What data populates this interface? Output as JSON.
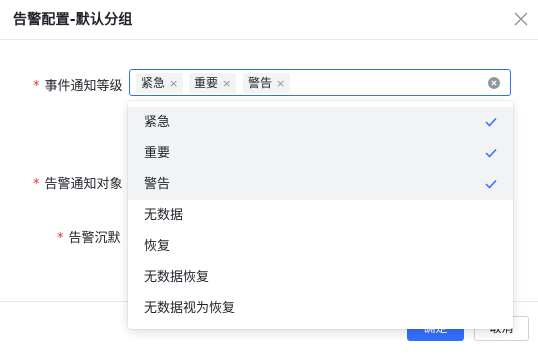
{
  "dialog": {
    "title": "告警配置-默认分组",
    "close_icon": "close-icon"
  },
  "form": {
    "level_label": "事件通知等级",
    "target_label": "告警通知对象",
    "silence_label": "告警沉默",
    "required_mark": "*",
    "selected_tags": [
      "紧急",
      "重要",
      "警告"
    ],
    "tag_remove_glyph": "×"
  },
  "dropdown": {
    "options": [
      {
        "label": "紧急",
        "selected": true
      },
      {
        "label": "重要",
        "selected": true
      },
      {
        "label": "警告",
        "selected": true
      },
      {
        "label": "无数据",
        "selected": false
      },
      {
        "label": "恢复",
        "selected": false
      },
      {
        "label": "无数据恢复",
        "selected": false
      },
      {
        "label": "无数据视为恢复",
        "selected": false
      }
    ]
  },
  "footer": {
    "ok_label": "确定",
    "cancel_label": "取消"
  },
  "colors": {
    "accent": "#3370ff",
    "required": "#e8363e",
    "selected_bg": "#f2f3f5"
  }
}
